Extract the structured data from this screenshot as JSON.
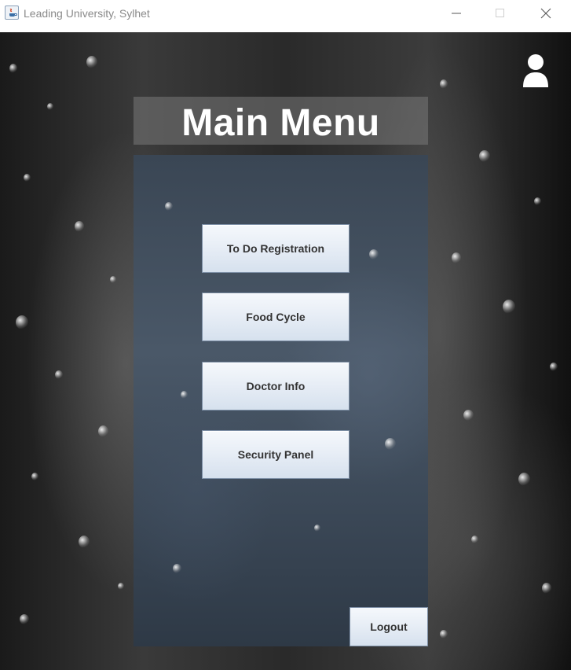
{
  "window": {
    "title": "Leading University, Sylhet",
    "controls": {
      "minimize_icon": "minimize-icon",
      "maximize_icon": "maximize-icon",
      "close_icon": "close-icon"
    }
  },
  "header": {
    "title": "Main Menu",
    "user_icon": "user-icon"
  },
  "menu": {
    "buttons": [
      {
        "label": "To Do Registration"
      },
      {
        "label": "Food Cycle"
      },
      {
        "label": "Doctor Info"
      },
      {
        "label": "Security Panel"
      }
    ]
  },
  "footer": {
    "logout_label": "Logout"
  },
  "colors": {
    "title_text": "#ffffff",
    "button_text": "#333333",
    "button_border": "#7d8fa6",
    "panel_bg": "#3a4654"
  }
}
